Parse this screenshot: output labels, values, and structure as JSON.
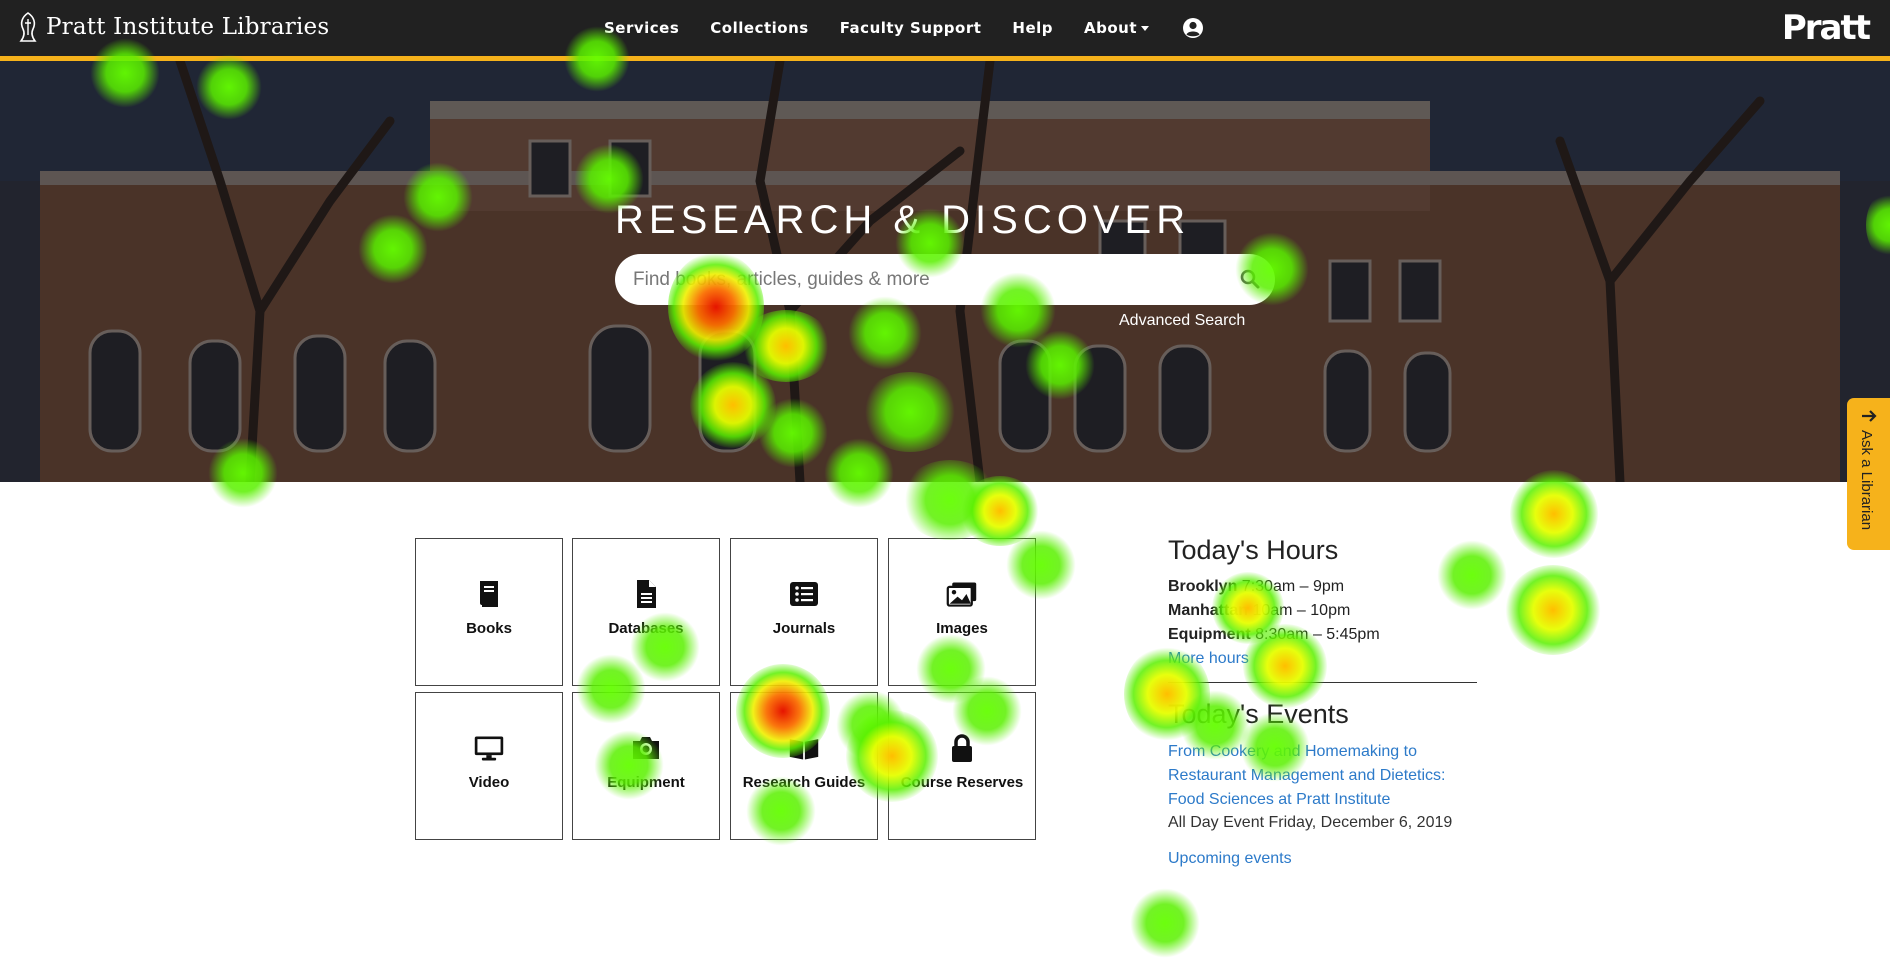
{
  "header": {
    "logo_text": "Pratt Institute Libraries",
    "brand": "Pratt",
    "nav": [
      "Services",
      "Collections",
      "Faculty Support",
      "Help",
      "About"
    ]
  },
  "hero": {
    "title": "RESEARCH & DISCOVER",
    "search_placeholder": "Find books, articles, guides & more",
    "advanced_search": "Advanced Search"
  },
  "ask_librarian": "Ask a Librarian",
  "tiles": [
    "Books",
    "Databases",
    "Journals",
    "Images",
    "Video",
    "Equipment",
    "Research Guides",
    "Course Reserves"
  ],
  "hours": {
    "title": "Today's Hours",
    "rows": [
      {
        "label": "Brooklyn",
        "value": "7:30am – 9pm"
      },
      {
        "label": "Manhattan",
        "value": "10am – 10pm"
      },
      {
        "label": "Equipment",
        "value": "8:30am – 5:45pm"
      }
    ],
    "more_link": "More hours"
  },
  "events": {
    "title": "Today's Events",
    "event_title": "From Cookery and Homemaking to Restaurant Management and Dietetics: Food Sciences at Pratt Institute",
    "event_meta": "All Day Event Friday, December 6, 2019",
    "upcoming_link": "Upcoming events"
  },
  "colors": {
    "nav_bg": "#212121",
    "accent": "#f6b21b",
    "link": "#2c7ac9",
    "heatmap_low": "#64ff00",
    "heatmap_mid": "#ffd400",
    "heatmap_high": "#e61400"
  }
}
